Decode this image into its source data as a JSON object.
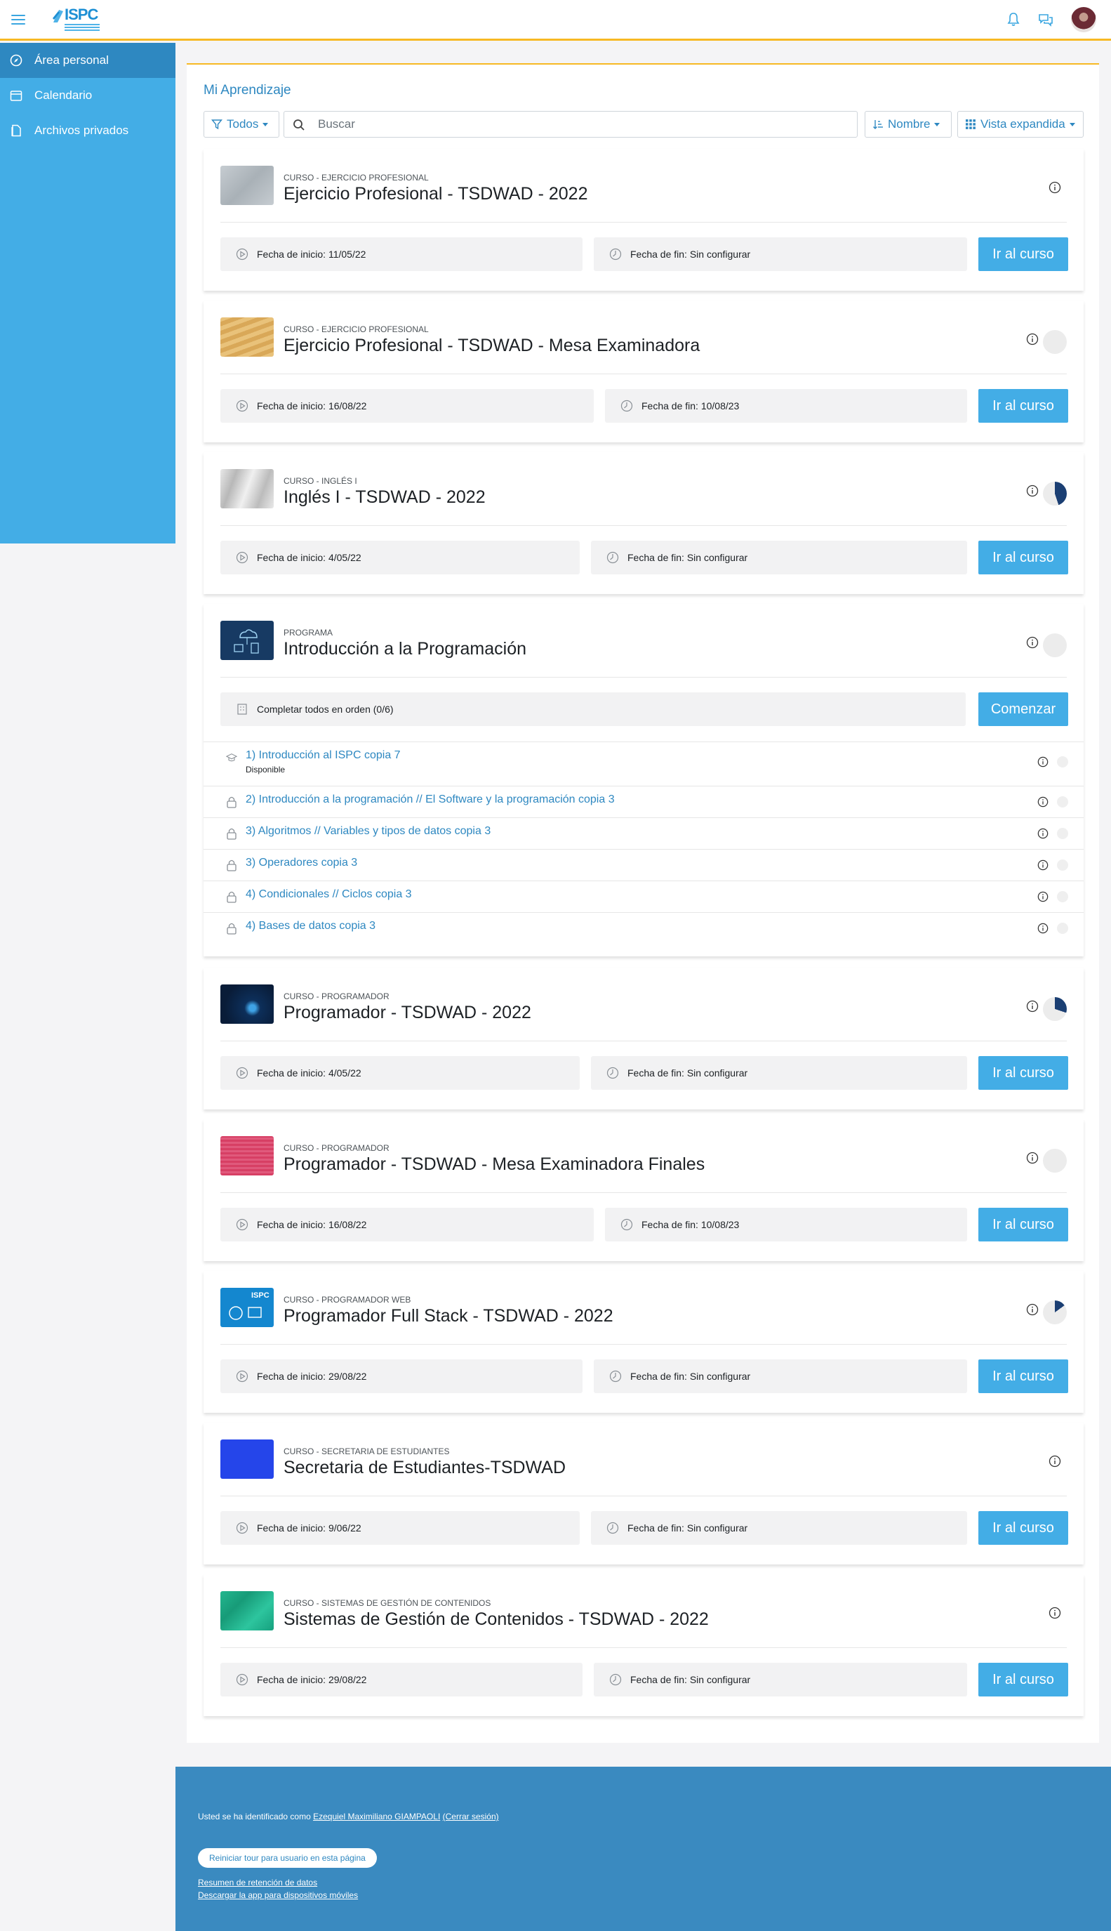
{
  "header": {
    "logo_text": "ISPC",
    "icons": [
      "menu-icon",
      "bell-icon",
      "chat-icon"
    ]
  },
  "sidebar": {
    "items": [
      {
        "label": "Área personal",
        "icon": "dashboard-icon",
        "active": true
      },
      {
        "label": "Calendario",
        "icon": "calendar-icon",
        "active": false
      },
      {
        "label": "Archivos privados",
        "icon": "file-icon",
        "active": false
      }
    ]
  },
  "main": {
    "title": "Mi Aprendizaje",
    "filter_label": "Todos",
    "search_placeholder": "Buscar",
    "sort_label": "Nombre",
    "view_label": "Vista expandida"
  },
  "labels": {
    "start_prefix": "Fecha de inicio: ",
    "end_prefix": "Fecha de fin: ",
    "go_button": "Ir al curso",
    "start_button": "Comenzar"
  },
  "courses": [
    {
      "category": "Curso - Ejercicio Profesional",
      "name": "Ejercicio Profesional - TSDWAD - 2022",
      "start": "Fecha de inicio: 11/05/22",
      "end": "Fecha de fin: Sin configurar",
      "progress": null,
      "thumb_color": "#b9c1c7"
    },
    {
      "category": "Curso - Ejercicio Profesional",
      "name": "Ejercicio Profesional - TSDWAD - Mesa Examinadora",
      "start": "Fecha de inicio: 16/08/22",
      "end": "Fecha de fin: 10/08/23",
      "progress": 0,
      "thumb_color": "#e1b56a"
    },
    {
      "category": "Curso - Inglés I",
      "name": "Inglés I - TSDWAD - 2022",
      "start": "Fecha de inicio: 4/05/22",
      "end": "Fecha de fin: Sin configurar",
      "progress": 0.45,
      "thumb_color": "#cfcfcf"
    },
    {
      "category": "Curso - Programador",
      "name": "Programador - TSDWAD - 2022",
      "start": "Fecha de inicio: 4/05/22",
      "end": "Fecha de fin: Sin configurar",
      "progress": 0.3,
      "thumb_color": "#0e2f5a"
    },
    {
      "category": "Curso - Programador",
      "name": "Programador - TSDWAD - Mesa Examinadora Finales",
      "start": "Fecha de inicio: 16/08/22",
      "end": "Fecha de fin: 10/08/23",
      "progress": 0,
      "thumb_color": "#e9799b"
    },
    {
      "category": "Curso - Programador Web",
      "name": "Programador Full Stack - TSDWAD - 2022",
      "start": "Fecha de inicio: 29/08/22",
      "end": "Fecha de fin: Sin configurar",
      "progress": 0.15,
      "thumb_color": "#1487cf"
    },
    {
      "category": "Curso - Secretaria de Estudiantes",
      "name": "Secretaria de Estudiantes-TSDWAD",
      "start": "Fecha de inicio: 9/06/22",
      "end": "Fecha de fin: Sin configurar",
      "progress": null,
      "thumb_color": "#2545ea"
    },
    {
      "category": "Curso - Sistemas de Gestión de Contenidos",
      "name": "Sistemas de Gestión de Contenidos - TSDWAD - 2022",
      "start": "Fecha de inicio: 29/08/22",
      "end": "Fecha de fin: Sin configurar",
      "progress": null,
      "thumb_color": "#1fae8b"
    }
  ],
  "program": {
    "category": "Programa",
    "name": "Introducción a la Programación",
    "order_text": "Completar todos en orden (0/6)",
    "items": [
      {
        "label": "1) Introducción al ISPC copia 7",
        "status": "Disponible",
        "locked": false
      },
      {
        "label": "2) Introducción a la programación // El Software y la programación copia 3",
        "status": "",
        "locked": true
      },
      {
        "label": "3) Algoritmos // Variables y tipos de datos copia 3",
        "status": "",
        "locked": true
      },
      {
        "label": "3) Operadores copia 3",
        "status": "",
        "locked": true
      },
      {
        "label": "4) Condicionales // Ciclos copia 3",
        "status": "",
        "locked": true
      },
      {
        "label": "4) Bases de datos copia 3",
        "status": "",
        "locked": true
      }
    ]
  },
  "footer": {
    "login_prefix": "Usted se ha identificado como ",
    "user_name": "Ezequiel Maximiliano GIAMPAOLI",
    "logout": "(Cerrar sesión)",
    "tour_button": "Reiniciar tour para usuario en esta página",
    "data_retention": "Resumen de retención de datos",
    "mobile_app": "Descargar la app para dispositivos móviles"
  },
  "colors": {
    "accent": "#43ade6",
    "link": "#2e88c1",
    "header_border": "#f7b924",
    "footer_bg": "#3a8ac0",
    "progress_fill": "#1b3f73"
  }
}
